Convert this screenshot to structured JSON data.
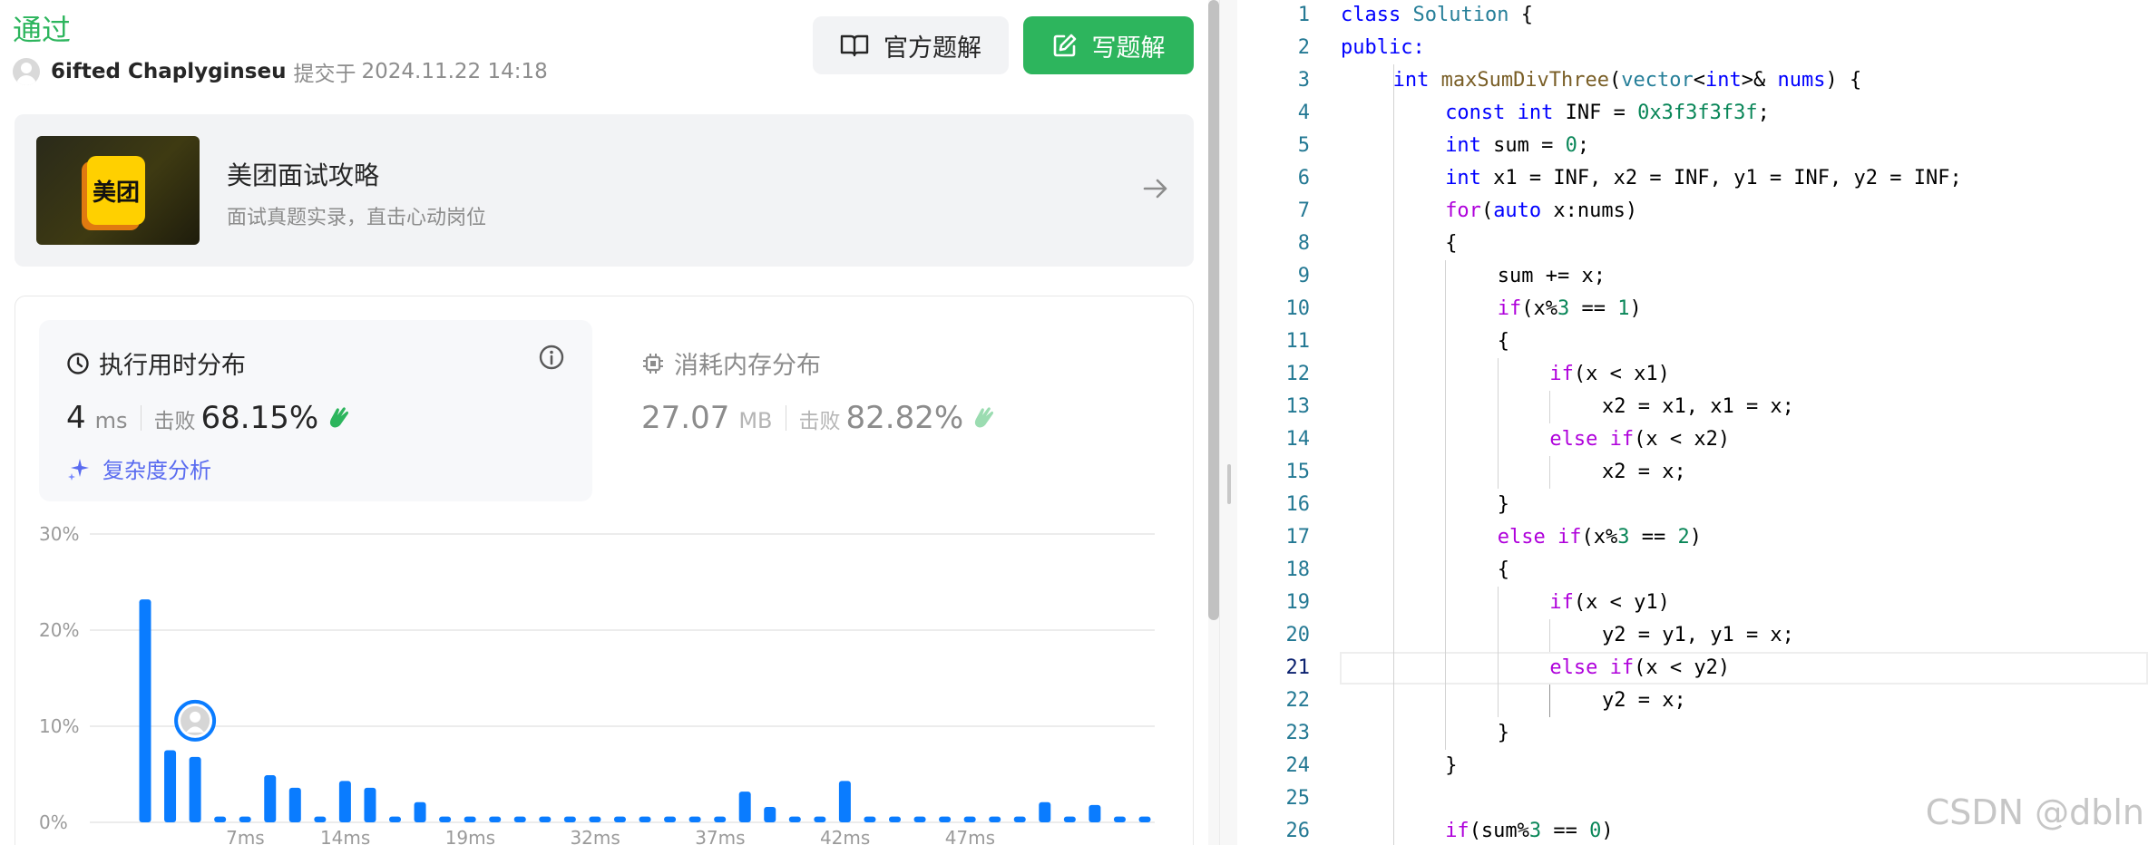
{
  "submission": {
    "status": "通过",
    "username": "6ifted Chaplyginseu",
    "submitted_prefix": "提交于",
    "submitted_at": "2024.11.22 14:18"
  },
  "header_buttons": {
    "official_solution": "官方题解",
    "write_solution": "写题解"
  },
  "banner": {
    "logo_text": "美团",
    "title": "美团面试攻略",
    "subtitle": "面试真题实录，直击心动岗位"
  },
  "runtime": {
    "title": "执行用时分布",
    "value": "4",
    "unit": "ms",
    "beats_label": "击败",
    "beats_pct": "68.15%",
    "analysis_link": "复杂度分析"
  },
  "memory": {
    "title": "消耗内存分布",
    "value": "27.07",
    "unit": "MB",
    "beats_label": "击败",
    "beats_pct": "82.82%"
  },
  "colors": {
    "accent_green": "#2db55d",
    "bar_blue": "#0a7cff",
    "link_purple": "#5a6cf0"
  },
  "icons": {
    "book": "book-open-icon",
    "edit": "pencil-square-icon",
    "arrow": "arrow-right-icon",
    "clock": "clock-icon",
    "info": "info-circle-icon",
    "chip": "chip-icon",
    "clap": "clap-hands-icon",
    "sparkle": "sparkle-icon"
  },
  "chart_data": {
    "type": "bar",
    "ylim": [
      0,
      30
    ],
    "y_ticks": [
      "30%",
      "20%",
      "10%",
      "0%"
    ],
    "x_tick_labels": [
      "7ms",
      "14ms",
      "19ms",
      "32ms",
      "37ms",
      "42ms",
      "47ms"
    ],
    "values": [
      23.2,
      7.5,
      6.8,
      0.6,
      0.6,
      4.9,
      3.6,
      0.6,
      4.3,
      3.6,
      0.6,
      2.1,
      0.6,
      0.6,
      0.6,
      0.6,
      0.6,
      0.6,
      0.6,
      0.6,
      0.6,
      0.6,
      0.6,
      0.6,
      3.2,
      1.6,
      0.6,
      0.6,
      4.3,
      0.6,
      0.6,
      0.6,
      0.6,
      0.6,
      0.6,
      0.6,
      2.1,
      0.6,
      1.8,
      0.6,
      0.6
    ],
    "user_bar_index": 2,
    "grid": true
  },
  "editor": {
    "active_line": 21,
    "lines": [
      {
        "n": "1",
        "indent": 0,
        "tokens": [
          [
            "kw",
            "class"
          ],
          [
            "",
            " "
          ],
          [
            "ty",
            "Solution"
          ],
          [
            "",
            " {"
          ]
        ]
      },
      {
        "n": "2",
        "indent": 0,
        "tokens": [
          [
            "kw",
            "public:"
          ]
        ]
      },
      {
        "n": "3",
        "indent": 1,
        "tokens": [
          [
            "kw",
            "int"
          ],
          [
            "",
            " "
          ],
          [
            "fn",
            "maxSumDivThree"
          ],
          [
            "",
            "("
          ],
          [
            "ty",
            "vector"
          ],
          [
            "",
            "<"
          ],
          [
            "kw",
            "int"
          ],
          [
            "",
            ">& "
          ],
          [
            "kw",
            "nums"
          ],
          [
            "",
            ") {"
          ]
        ]
      },
      {
        "n": "4",
        "indent": 2,
        "tokens": [
          [
            "kw",
            "const"
          ],
          [
            "",
            " "
          ],
          [
            "kw",
            "int"
          ],
          [
            "",
            " INF = "
          ],
          [
            "num",
            "0x3f3f3f3f"
          ],
          [
            "",
            ";"
          ]
        ]
      },
      {
        "n": "5",
        "indent": 2,
        "tokens": [
          [
            "kw",
            "int"
          ],
          [
            "",
            " sum = "
          ],
          [
            "num",
            "0"
          ],
          [
            "",
            ";"
          ]
        ]
      },
      {
        "n": "6",
        "indent": 2,
        "tokens": [
          [
            "kw",
            "int"
          ],
          [
            "",
            " x1 = INF, x2 = INF, y1 = INF, y2 = INF;"
          ]
        ]
      },
      {
        "n": "7",
        "indent": 2,
        "tokens": [
          [
            "ctl",
            "for"
          ],
          [
            "",
            "("
          ],
          [
            "kw",
            "auto"
          ],
          [
            "",
            " x:nums)"
          ]
        ]
      },
      {
        "n": "8",
        "indent": 2,
        "tokens": [
          [
            "",
            "{"
          ]
        ]
      },
      {
        "n": "9",
        "indent": 3,
        "tokens": [
          [
            "",
            "sum += x;"
          ]
        ]
      },
      {
        "n": "10",
        "indent": 3,
        "tokens": [
          [
            "ctl",
            "if"
          ],
          [
            "",
            "(x%"
          ],
          [
            "num",
            "3"
          ],
          [
            "",
            " == "
          ],
          [
            "num",
            "1"
          ],
          [
            "",
            ")"
          ]
        ]
      },
      {
        "n": "11",
        "indent": 3,
        "tokens": [
          [
            "",
            "{"
          ]
        ]
      },
      {
        "n": "12",
        "indent": 4,
        "tokens": [
          [
            "ctl",
            "if"
          ],
          [
            "",
            "(x < x1)"
          ]
        ]
      },
      {
        "n": "13",
        "indent": 5,
        "tokens": [
          [
            "",
            "x2 = x1, x1 = x;"
          ]
        ]
      },
      {
        "n": "14",
        "indent": 4,
        "tokens": [
          [
            "ctl",
            "else"
          ],
          [
            "",
            " "
          ],
          [
            "ctl",
            "if"
          ],
          [
            "",
            "(x < x2)"
          ]
        ]
      },
      {
        "n": "15",
        "indent": 5,
        "tokens": [
          [
            "",
            "x2 = x;"
          ]
        ]
      },
      {
        "n": "16",
        "indent": 3,
        "tokens": [
          [
            "",
            "}"
          ]
        ]
      },
      {
        "n": "17",
        "indent": 3,
        "tokens": [
          [
            "ctl",
            "else"
          ],
          [
            "",
            " "
          ],
          [
            "ctl",
            "if"
          ],
          [
            "",
            "(x%"
          ],
          [
            "num",
            "3"
          ],
          [
            "",
            " == "
          ],
          [
            "num",
            "2"
          ],
          [
            "",
            ")"
          ]
        ]
      },
      {
        "n": "18",
        "indent": 3,
        "tokens": [
          [
            "",
            "{"
          ]
        ]
      },
      {
        "n": "19",
        "indent": 4,
        "tokens": [
          [
            "ctl",
            "if"
          ],
          [
            "",
            "(x < y1)"
          ]
        ]
      },
      {
        "n": "20",
        "indent": 5,
        "tokens": [
          [
            "",
            "y2 = y1, y1 = x;"
          ]
        ]
      },
      {
        "n": "21",
        "indent": 4,
        "tokens": [
          [
            "ctl",
            "else"
          ],
          [
            "",
            " "
          ],
          [
            "ctl",
            "if"
          ],
          [
            "",
            "(x < y2)"
          ]
        ]
      },
      {
        "n": "22",
        "indent": 5,
        "tokens": [
          [
            "",
            "y2 = x;"
          ]
        ]
      },
      {
        "n": "23",
        "indent": 3,
        "tokens": [
          [
            "",
            "}"
          ]
        ]
      },
      {
        "n": "24",
        "indent": 2,
        "tokens": [
          [
            "",
            "}"
          ]
        ]
      },
      {
        "n": "25",
        "indent": 0,
        "tokens": []
      },
      {
        "n": "26",
        "indent": 2,
        "tokens": [
          [
            "ctl",
            "if"
          ],
          [
            "",
            "(sum%"
          ],
          [
            "num",
            "3"
          ],
          [
            "",
            " == "
          ],
          [
            "num",
            "0"
          ],
          [
            "",
            ")"
          ]
        ]
      }
    ]
  },
  "watermark": "CSDN @dbln"
}
